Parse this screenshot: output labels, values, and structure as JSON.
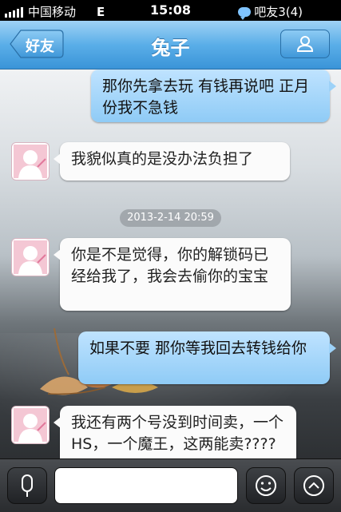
{
  "status_bar": {
    "carrier": "中国移动",
    "network": "E",
    "time": "15:08",
    "notification": "吧友3(4)"
  },
  "nav": {
    "back_label": "好友",
    "title": "兔子"
  },
  "messages": [
    {
      "from": "me",
      "text": "那你先拿去玩 有钱再说吧 正月份我不急钱"
    },
    {
      "from": "friend",
      "text": "我貌似真的是没办法负担了"
    },
    {
      "timestamp": "2013-2-14 20:59"
    },
    {
      "from": "friend",
      "text": "你是不是觉得，你的解锁码已经给我了，我会去偷你的宝宝"
    },
    {
      "from": "me",
      "text": "如果不要 那你等我回去转钱给你"
    },
    {
      "from": "friend",
      "text": "我还有两个号没到时间卖，一个HS，一个魔王，这两能卖????"
    }
  ],
  "input": {
    "placeholder": ""
  },
  "colors": {
    "nav": "#3a94d8",
    "outgoing_bubble": "#8fcbf6",
    "incoming_bubble": "#fbfbfb"
  }
}
